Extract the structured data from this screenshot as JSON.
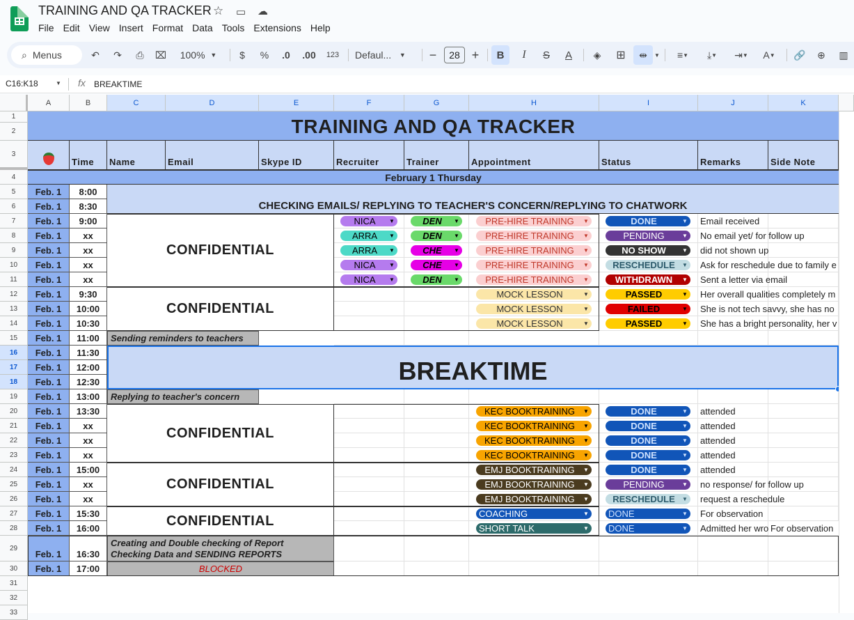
{
  "app": {
    "title": "TRAINING AND QA TRACKER",
    "menus": [
      "File",
      "Edit",
      "View",
      "Insert",
      "Format",
      "Data",
      "Tools",
      "Extensions",
      "Help"
    ]
  },
  "toolbar": {
    "search_label": "Menus",
    "zoom": "100%",
    "currency": "$",
    "percent": "%",
    "dec_minus": ".0",
    "dec_plus": ".00",
    "number_format": "123",
    "font": "Defaul...",
    "font_size": "28",
    "minus": "−",
    "plus": "+"
  },
  "formula_bar": {
    "name_box": "C16:K18",
    "fx": "fx",
    "value": "BREAKTIME"
  },
  "columns": [
    "A",
    "B",
    "C",
    "D",
    "E",
    "F",
    "G",
    "H",
    "I",
    "J",
    "K"
  ],
  "rows": [
    "1",
    "2",
    "3",
    "4",
    "5",
    "6",
    "7",
    "8",
    "9",
    "10",
    "11",
    "12",
    "13",
    "14",
    "15",
    "16",
    "17",
    "18",
    "19",
    "20",
    "21",
    "22",
    "23",
    "24",
    "25",
    "26",
    "27",
    "28",
    "29",
    "30",
    "31",
    "32",
    "33"
  ],
  "sheet": {
    "title": "TRAINING AND QA TRACKER",
    "headers": [
      "Time",
      "Name",
      "Email",
      "Skype ID",
      "Recruiter",
      "Trainer",
      "Appointment",
      "Status",
      "Remarks",
      "Side Note"
    ],
    "date_banner": "February 1 Thursday",
    "checking_banner": "CHECKING EMAILS/ REPLYING TO TEACHER'S CONCERN/REPLYING TO CHATWORK",
    "breaktime": "BREAKTIME",
    "confidential": "CONFIDENTIAL",
    "date_label": "Feb. 1",
    "times": [
      "8:00",
      "8:30",
      "9:00",
      "xx",
      "xx",
      "xx",
      "xx",
      "9:30",
      "10:00",
      "10:30",
      "11:00",
      "11:30",
      "12:00",
      "12:30",
      "13:00",
      "13:30",
      "xx",
      "xx",
      "xx",
      "15:00",
      "xx",
      "xx",
      "15:30",
      "16:00",
      "16:30",
      "17:00"
    ],
    "task_reminders": "Sending reminders to teachers",
    "task_reply": "Replying to teacher's concern",
    "task_report_1": "Creating and Double checking of Report",
    "task_report_2": "Checking Data and SENDING REPORTS",
    "blocked": "BLOCKED",
    "recruiters": [
      "NICA",
      "ARRA",
      "ARRA",
      "NICA",
      "NICA"
    ],
    "trainers": [
      "DEN",
      "DEN",
      "CHE",
      "CHE",
      "DEN"
    ],
    "appointments": [
      "PRE-HIRE TRAINING",
      "PRE-HIRE TRAINING",
      "PRE-HIRE TRAINING",
      "PRE-HIRE TRAINING",
      "PRE-HIRE TRAINING",
      "MOCK LESSON",
      "MOCK LESSON",
      "MOCK LESSON",
      "KEC BOOKTRAINING",
      "KEC BOOKTRAINING",
      "KEC BOOKTRAINING",
      "KEC BOOKTRAINING",
      "EMJ BOOKTRAINING",
      "EMJ BOOKTRAINING",
      "EMJ BOOKTRAINING",
      "COACHING",
      "SHORT TALK"
    ],
    "statuses": [
      "DONE",
      "PENDING",
      "NO SHOW",
      "RESCHEDULE",
      "WITHDRAWN",
      "PASSED",
      "FAILED",
      "PASSED",
      "DONE",
      "DONE",
      "DONE",
      "DONE",
      "DONE",
      "PENDING",
      "RESCHEDULE",
      "DONE",
      "DONE"
    ],
    "remarks": [
      "Email received",
      "No email yet/ for follow up",
      "did not shown up",
      "Ask for reschedule due to family e",
      "Sent a letter via email",
      "Her overall qualities completely m",
      "She is not tech savvy, she has no",
      "She has a bright personality, her v",
      "attended",
      "attended",
      "attended",
      "attended",
      "attended",
      "no response/ for follow up",
      "request a reschedule",
      "For observation",
      "Admitted her wro"
    ],
    "side_note_28": "For observation"
  },
  "colors": {
    "header_blue": "#8eb0f0",
    "light_blue": "#c9d9f6",
    "task_gray": "#b7b7b7"
  }
}
